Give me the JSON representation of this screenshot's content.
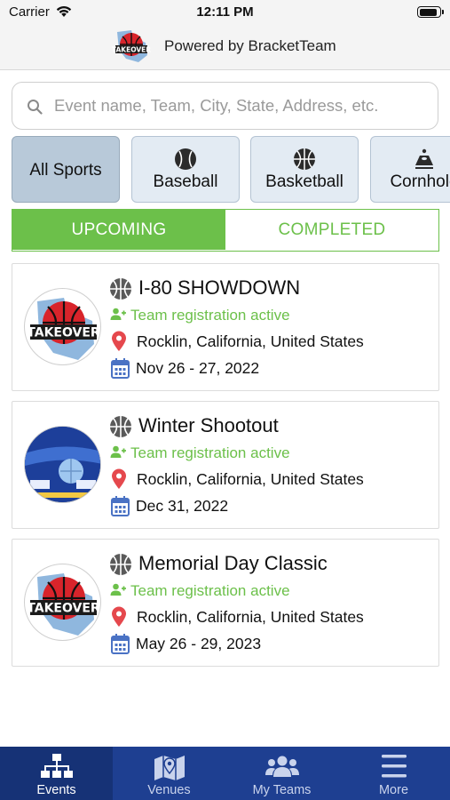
{
  "status_bar": {
    "carrier": "Carrier",
    "time": "12:11 PM"
  },
  "header": {
    "title": "Powered by BracketTeam",
    "logo_icon": "takeover-logo-icon"
  },
  "search": {
    "placeholder": "Event name, Team, City, State, Address, etc.",
    "value": "",
    "icon": "search-icon"
  },
  "sports": [
    {
      "label": "All Sports",
      "icon": "",
      "selected": true
    },
    {
      "label": "Baseball",
      "icon": "baseball-icon",
      "selected": false
    },
    {
      "label": "Basketball",
      "icon": "basketball-icon",
      "selected": false
    },
    {
      "label": "Cornhole",
      "icon": "cornhole-icon",
      "selected": false
    }
  ],
  "segments": {
    "upcoming": "UPCOMING",
    "completed": "COMPLETED",
    "selected": "upcoming"
  },
  "events": [
    {
      "title": "I-80 SHOWDOWN",
      "registration": "Team registration active",
      "location": "Rocklin, California, United States",
      "dates": "Nov 26 - 27, 2022",
      "logo": "takeover-logo-icon"
    },
    {
      "title": "Winter Shootout",
      "registration": "Team registration active",
      "location": "Rocklin, California, United States",
      "dates": "Dec 31, 2022",
      "logo": "winter-shootout-logo-icon"
    },
    {
      "title": "Memorial Day Classic",
      "registration": "Team registration active",
      "location": "Rocklin, California, United States",
      "dates": "May 26 - 29, 2023",
      "logo": "takeover-logo-icon"
    }
  ],
  "tab_bar": {
    "items": [
      {
        "label": "Events",
        "icon": "bracket-icon",
        "active": true
      },
      {
        "label": "Venues",
        "icon": "map-icon",
        "active": false
      },
      {
        "label": "My Teams",
        "icon": "group-icon",
        "active": false
      },
      {
        "label": "More",
        "icon": "menu-icon",
        "active": false
      }
    ]
  },
  "colors": {
    "accent_green": "#6cc04a",
    "tab_bar_blue": "#1e3f91",
    "chip_bg": "#e3ebf3",
    "chip_selected_bg": "#b8c9d9",
    "icon_red": "#e5484d",
    "icon_blue": "#4a72c4"
  }
}
